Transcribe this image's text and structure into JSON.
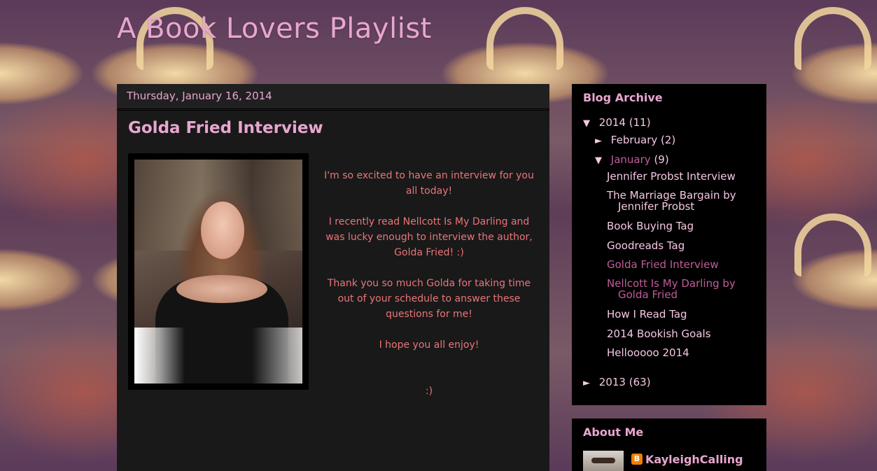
{
  "blog": {
    "title": "A Book Lovers Playlist"
  },
  "post": {
    "date": "Thursday, January 16, 2014",
    "title": "Golda Fried Interview",
    "paragraphs": [
      "I'm so excited to have an interview for you all today!",
      "I recently read Nellcott Is My Darling and was lucky enough to interview the author, Golda Fried! :)",
      "Thank you so much Golda for taking time out of your schedule to answer these questions for me!",
      "I hope you all enjoy!"
    ],
    "closing": ":)"
  },
  "archive": {
    "title": "Blog Archive",
    "year2014": {
      "toggle": "▼",
      "label": "2014",
      "count": "(11)"
    },
    "february": {
      "toggle": "►",
      "label": "February",
      "count": "(2)"
    },
    "january": {
      "toggle": "▼",
      "label": "January",
      "count": "(9)"
    },
    "posts": [
      {
        "line1": "Jennifer Probst Interview",
        "line2": ""
      },
      {
        "line1": "The Marriage Bargain by",
        "line2": "Jennifer Probst"
      },
      {
        "line1": "Book Buying Tag",
        "line2": ""
      },
      {
        "line1": "Goodreads Tag",
        "line2": ""
      },
      {
        "line1": "Golda Fried Interview",
        "line2": ""
      },
      {
        "line1": "Nellcott Is My Darling by",
        "line2": "Golda Fried"
      },
      {
        "line1": "How I Read Tag",
        "line2": ""
      },
      {
        "line1": "2014 Bookish Goals",
        "line2": ""
      },
      {
        "line1": "Hellooooo 2014",
        "line2": ""
      }
    ],
    "year2013": {
      "toggle": "►",
      "label": "2013",
      "count": "(63)"
    }
  },
  "about": {
    "title": "About Me",
    "blogger_glyph": "B",
    "profile_name": "KayleighCalling"
  },
  "colors": {
    "title_pink": "#e8a6cf",
    "body_text": "#e8757a",
    "active_link": "#c05c9a",
    "panel_bg": "#191919"
  }
}
